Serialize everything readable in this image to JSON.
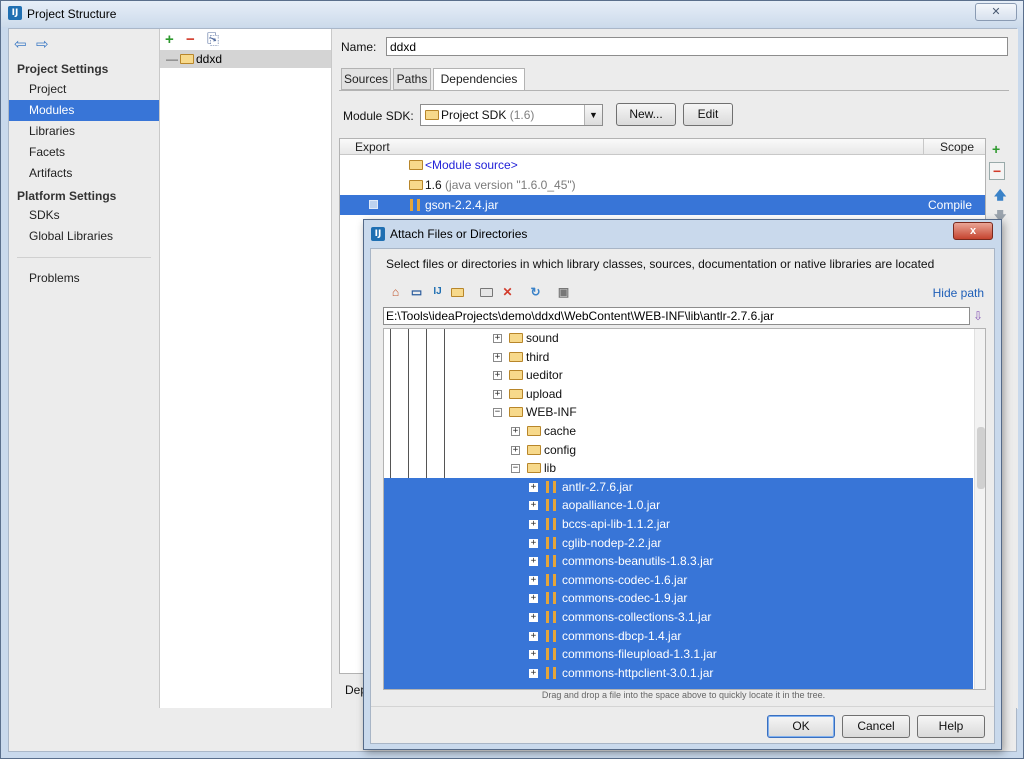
{
  "window": {
    "title": "Project Structure",
    "app_icon": "intellij-icon",
    "close_glyph": "✕"
  },
  "left_nav": {
    "back_glyph": "⇦",
    "forward_glyph": "⇨",
    "project_settings_heading": "Project Settings",
    "project_settings_items": [
      "Project",
      "Modules",
      "Libraries",
      "Facets",
      "Artifacts"
    ],
    "platform_settings_heading": "Platform Settings",
    "platform_settings_items": [
      "SDKs",
      "Global Libraries"
    ],
    "problems_label": "Problems",
    "selected_item": "Modules"
  },
  "module_tree": {
    "add_glyph": "+",
    "remove_glyph": "−",
    "copy_glyph": "⎘",
    "module_name": "ddxd"
  },
  "module_panel": {
    "name_label": "Name:",
    "name_value": "ddxd",
    "tabs": [
      "Sources",
      "Paths",
      "Dependencies"
    ],
    "active_tab": "Dependencies",
    "module_sdk_label": "Module SDK:",
    "sdk_value": "Project SDK",
    "sdk_version_hint": "(1.6)",
    "new_button": "New...",
    "edit_button": "Edit",
    "table_headers": {
      "export": "Export",
      "scope": "Scope"
    },
    "dependencies": [
      {
        "name": "<Module source>",
        "hint": "",
        "scope": ""
      },
      {
        "name": "1.6",
        "hint": "(java version \"1.6.0_45\")",
        "scope": ""
      },
      {
        "name": "gson-2.2.4.jar",
        "hint": "",
        "scope": "Compile"
      }
    ],
    "selected_dependency": "gson-2.2.4.jar",
    "side_add": "+",
    "side_remove": "−",
    "side_up": "🡅",
    "side_down": "🡇",
    "bottom_label_partial": "Dep"
  },
  "dialog": {
    "title": "Attach Files or Directories",
    "close_glyph": "x",
    "description": "Select files or directories in which library classes, sources, documentation or native libraries are located",
    "hide_path_link": "Hide path",
    "path_value": "E:\\Tools\\ideaProjects\\demo\\ddxd\\WebContent\\WEB-INF\\lib\\antlr-2.7.6.jar",
    "toolbar_icons": [
      "home-icon",
      "desktop-icon",
      "project-icon",
      "module-folder-icon",
      "new-folder-icon",
      "delete-icon",
      "refresh-icon",
      "show-hidden-icon"
    ],
    "tree": {
      "folders_level1": [
        "sound",
        "third",
        "ueditor",
        "upload",
        "WEB-INF"
      ],
      "folders_level2": [
        "cache",
        "config",
        "lib"
      ],
      "jars": [
        "antlr-2.7.6.jar",
        "aopalliance-1.0.jar",
        "bccs-api-lib-1.1.2.jar",
        "cglib-nodep-2.2.jar",
        "commons-beanutils-1.8.3.jar",
        "commons-codec-1.6.jar",
        "commons-codec-1.9.jar",
        "commons-collections-3.1.jar",
        "commons-dbcp-1.4.jar",
        "commons-fileupload-1.3.1.jar",
        "commons-httpclient-3.0.1.jar"
      ]
    },
    "drag_hint": "Drag and drop a file into the space above to quickly locate it in the tree.",
    "ok_button": "OK",
    "cancel_button": "Cancel",
    "help_button": "Help"
  },
  "colors": {
    "selection": "#3875d7",
    "panel_bg": "#ececec",
    "window_frame": "#c9d9ec",
    "link": "#1f5fb8"
  }
}
